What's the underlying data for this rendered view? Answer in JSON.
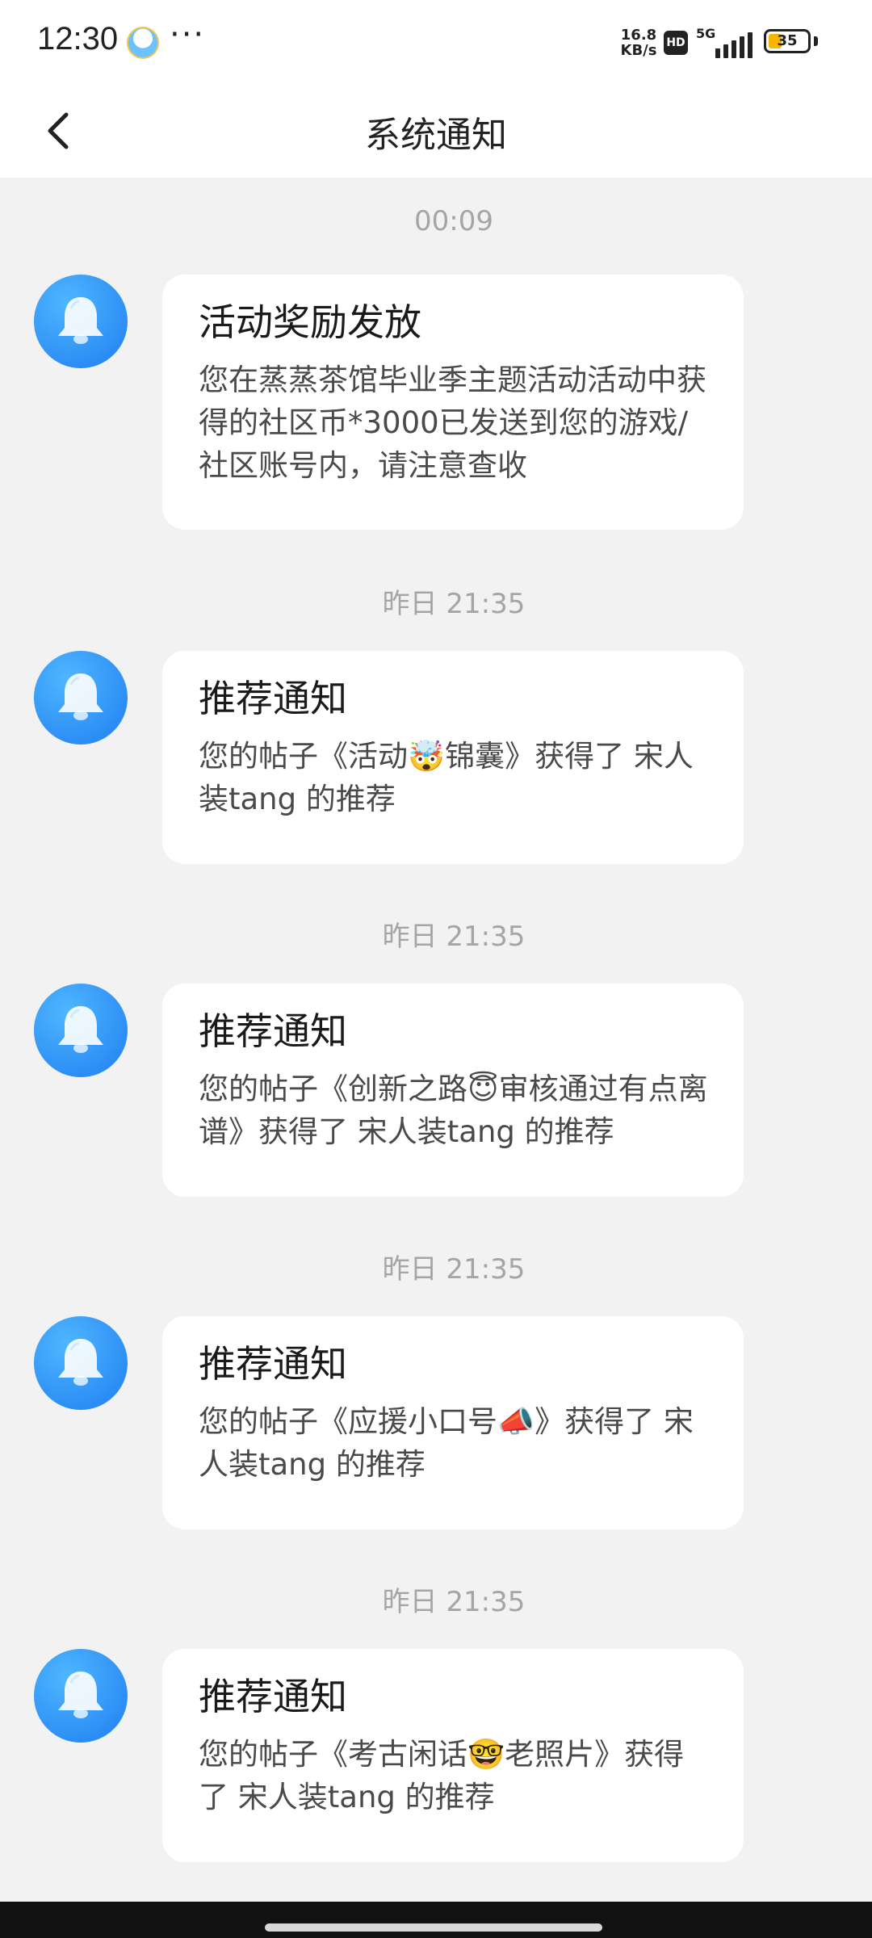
{
  "status_bar": {
    "time": "12:30",
    "more": "···",
    "net_speed_value": "16.8",
    "net_speed_unit": "KB/s",
    "hd": "HD",
    "network": "5G",
    "battery": "35"
  },
  "nav": {
    "title": "系统通知"
  },
  "messages": [
    {
      "time": "00:09",
      "title": "活动奖励发放",
      "body": "您在蒸蒸茶馆毕业季主题活动活动中获得的社区币*3000已发送到您的游戏/社区账号内，请注意查收"
    },
    {
      "time": "昨日 21:35",
      "title": "推荐通知",
      "body": "您的帖子《活动🤯锦囊》获得了 宋人装tang 的推荐"
    },
    {
      "time": "昨日 21:35",
      "title": "推荐通知",
      "body": "您的帖子《创新之路😇审核通过有点离谱》获得了 宋人装tang 的推荐"
    },
    {
      "time": "昨日 21:35",
      "title": "推荐通知",
      "body": "您的帖子《应援小口号📣》获得了 宋人装tang 的推荐"
    },
    {
      "time": "昨日 21:35",
      "title": "推荐通知",
      "body": "您的帖子《考古闲话🤓老照片》获得了 宋人装tang 的推荐"
    }
  ],
  "icons": {
    "back": "chevron-left-icon",
    "avatar": "bell-icon"
  },
  "colors": {
    "accent": "#2d8ff5",
    "background": "#f2f2f2",
    "card": "#ffffff"
  }
}
